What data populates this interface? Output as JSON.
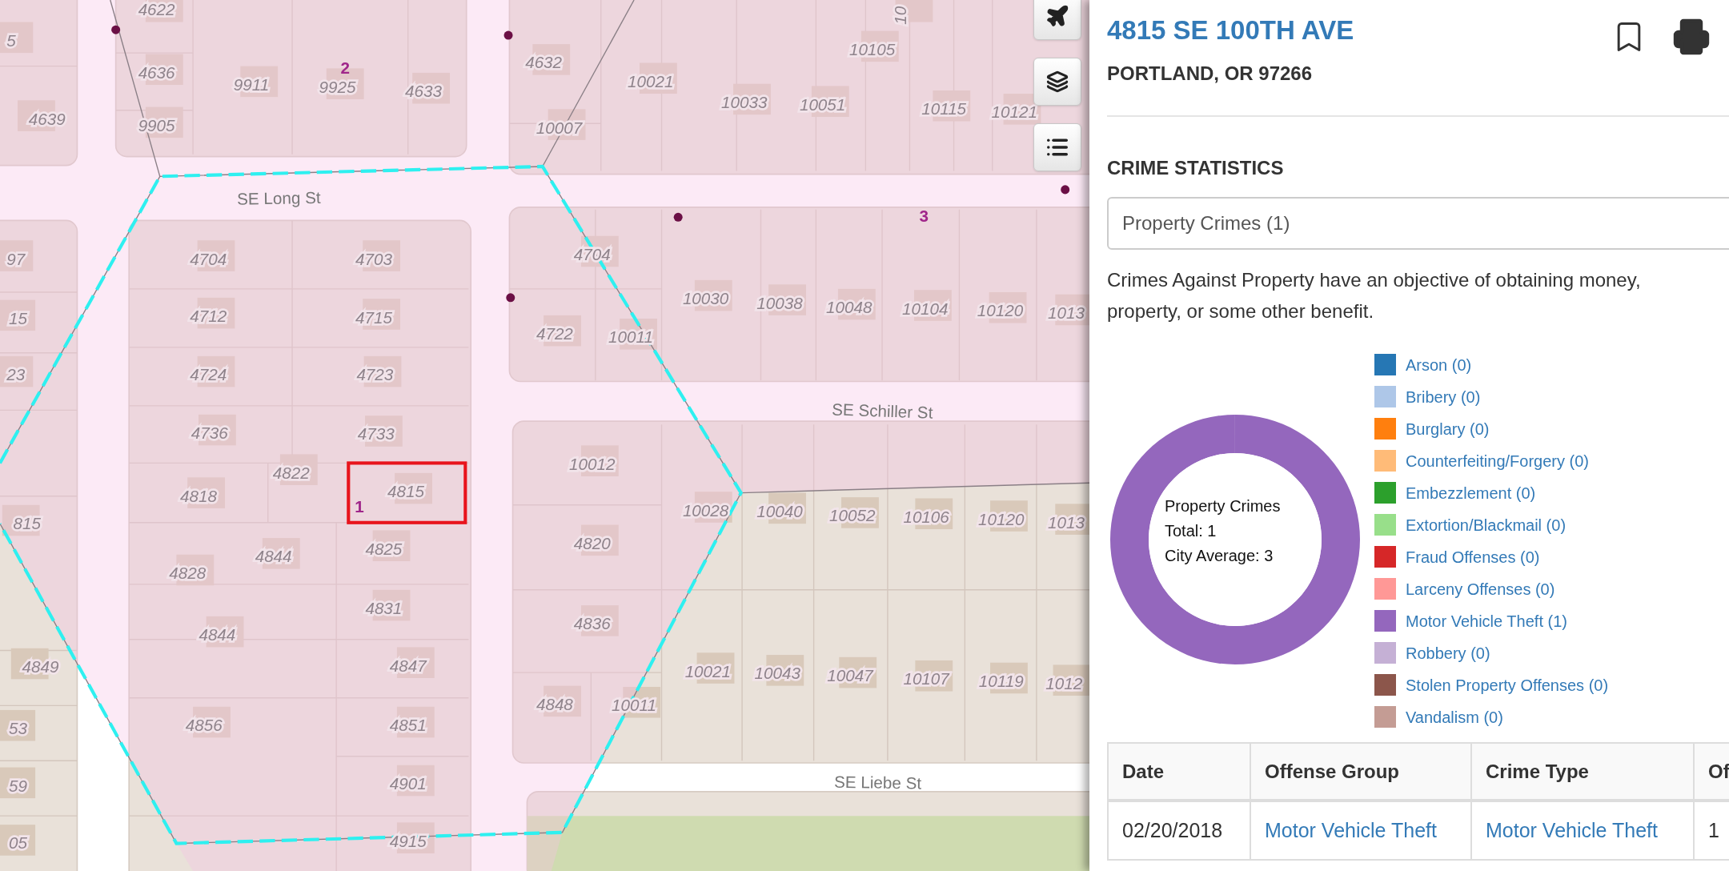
{
  "map": {
    "parcel_numbers": [
      "4622",
      "5",
      "4636",
      "9911",
      "9925",
      "4633",
      "4632",
      "10021",
      "10033",
      "10051",
      "10105",
      "10115",
      "10121",
      "4639",
      "9905",
      "10007",
      "97",
      "4704",
      "4703",
      "4704",
      "15",
      "4712",
      "4715",
      "4722",
      "10011",
      "10030",
      "10038",
      "10048",
      "10104",
      "10120",
      "1013",
      "23",
      "4724",
      "4723",
      "4736",
      "4733",
      "10012",
      "4818",
      "4822",
      "4815",
      "815",
      "10028",
      "10040",
      "10052",
      "10106",
      "10120",
      "1013",
      "4828",
      "4844",
      "4825",
      "4820",
      "4831",
      "4836",
      "4844",
      "4849",
      "4847",
      "10021",
      "10043",
      "10047",
      "10107",
      "10119",
      "1012",
      "4848",
      "10011",
      "53",
      "4856",
      "4851",
      "59",
      "4901",
      "05",
      "4915",
      "10"
    ],
    "cluster_numbers": [
      "2",
      "3",
      "1"
    ],
    "street_names": [
      "SE Long St",
      "SE Schiller St",
      "SE Liebe St"
    ]
  },
  "panel": {
    "title": "4815 SE 100TH AVE",
    "subtitle": "PORTLAND, OR 97266",
    "section_title": "CRIME STATISTICS",
    "select": {
      "value": "Property Crimes (1)"
    },
    "description": "Crimes Against Property have an objective of obtaining money, property, or some other benefit.",
    "chart_center": [
      "Property Crimes",
      "Total: 1",
      "City Average: 3"
    ],
    "chart_data": {
      "type": "donut",
      "categories": [
        "Arson (0)",
        "Bribery (0)",
        "Burglary (0)",
        "Counterfeiting/Forgery (0)",
        "Embezzlement (0)",
        "Extortion/Blackmail (0)",
        "Fraud Offenses (0)",
        "Larceny Offenses (0)",
        "Motor Vehicle Theft (1)",
        "Robbery (0)",
        "Stolen Property Offenses (0)",
        "Vandalism (0)"
      ],
      "values": [
        0,
        0,
        0,
        0,
        0,
        0,
        0,
        0,
        1,
        0,
        0,
        0
      ]
    },
    "legend": [
      {
        "color": "#2677b4"
      },
      {
        "color": "#aec7e8"
      },
      {
        "color": "#ff7f0e"
      },
      {
        "color": "#ffbb78"
      },
      {
        "color": "#2ca02c"
      },
      {
        "color": "#98df8a"
      },
      {
        "color": "#d62728"
      },
      {
        "color": "#ff9896"
      },
      {
        "color": "#9467bd"
      },
      {
        "color": "#c5b0d5"
      },
      {
        "color": "#8c564b"
      },
      {
        "color": "#c49c94"
      }
    ],
    "table": {
      "columns": [
        "Date",
        "Offense Group",
        "Crime Type",
        "Of"
      ],
      "rows": [
        {
          "cells": [
            {
              "text": "02/20/2018",
              "kind": "plain"
            },
            {
              "text": "Motor Vehicle Theft",
              "kind": "link"
            },
            {
              "text": "Motor Vehicle Theft",
              "kind": "link"
            },
            {
              "text": "1",
              "kind": "plain"
            }
          ]
        }
      ]
    }
  }
}
